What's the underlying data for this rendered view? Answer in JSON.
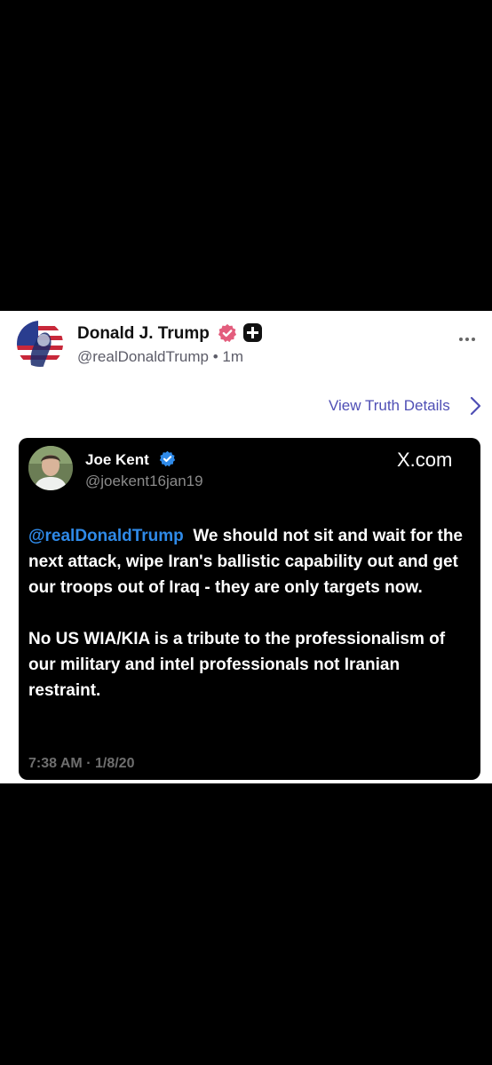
{
  "post": {
    "author_name": "Donald J. Trump",
    "author_handle": "@realDonaldTrump",
    "time_ago": "1m",
    "view_details_label": "View Truth Details",
    "colors": {
      "link": "#4f4fb5",
      "verified": "#e35d7d"
    }
  },
  "embed": {
    "name": "Joe Kent",
    "handle": "@joekent16jan19",
    "source": "X.com",
    "mention": "@realDonaldTrump",
    "paragraph1_rest": "We should not sit and wait for the next attack, wipe Iran's ballistic capability out and get our troops out of Iraq - they are only targets now.",
    "paragraph2": "No US WIA/KIA is a tribute to the professionalism of our military and intel professionals not Iranian restraint.",
    "timestamp": "7:38 AM · 1/8/20",
    "colors": {
      "mention": "#2f8ae8",
      "background": "#000000"
    }
  }
}
